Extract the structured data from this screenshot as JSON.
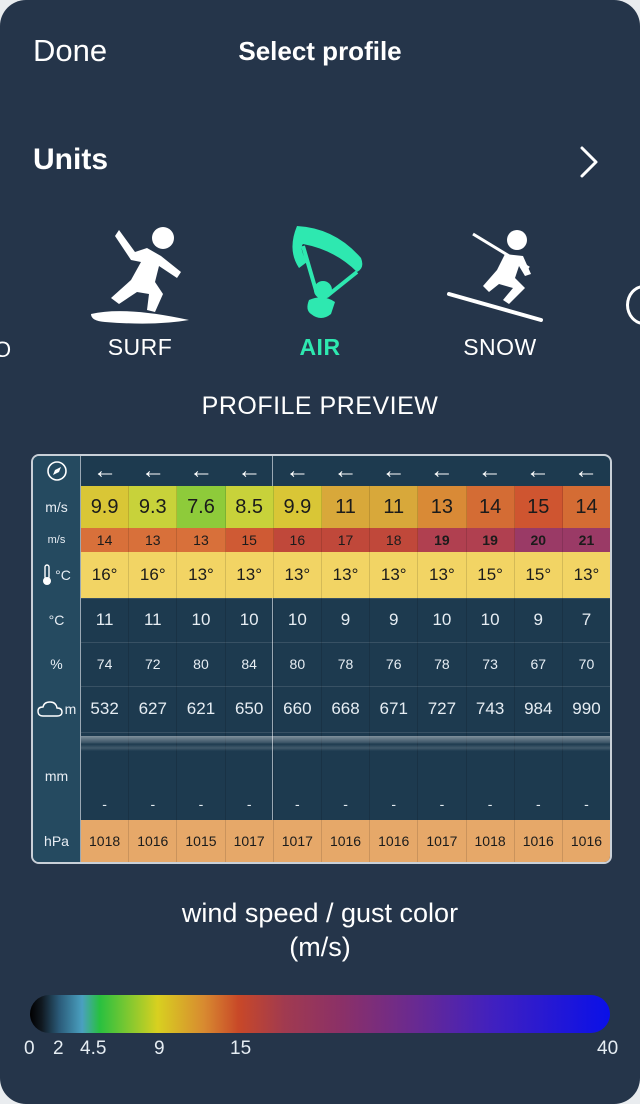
{
  "header": {
    "done_label": "Done",
    "title": "Select profile"
  },
  "units": {
    "label": "Units"
  },
  "profiles": [
    {
      "label": "SURF",
      "icon": "surf-icon",
      "active": false
    },
    {
      "label": "AIR",
      "icon": "kite-icon",
      "active": true
    },
    {
      "label": "SNOW",
      "icon": "ski-icon",
      "active": false
    }
  ],
  "edge_left_label": "O",
  "preview": {
    "title": "PROFILE PREVIEW",
    "row_labels": {
      "direction": "",
      "wind": "m/s",
      "gust": "m/s",
      "temp": "°C",
      "dew": "°C",
      "humidity": "%",
      "cloud": "m",
      "rain": "mm",
      "pressure": "hPa"
    },
    "wind": [
      "9.9",
      "9.3",
      "7.6",
      "8.5",
      "9.9",
      "11",
      "11",
      "13",
      "14",
      "15",
      "14"
    ],
    "gust": [
      "14",
      "13",
      "13",
      "15",
      "16",
      "17",
      "18",
      "19",
      "19",
      "20",
      "21"
    ],
    "temp": [
      "16°",
      "16°",
      "13°",
      "13°",
      "13°",
      "13°",
      "13°",
      "13°",
      "15°",
      "15°",
      "13°"
    ],
    "dew": [
      "11",
      "11",
      "10",
      "10",
      "10",
      "9",
      "9",
      "10",
      "10",
      "9",
      "7"
    ],
    "humidity": [
      "74",
      "72",
      "80",
      "84",
      "80",
      "78",
      "76",
      "78",
      "73",
      "67",
      "70"
    ],
    "cloud": [
      "532",
      "627",
      "621",
      "650",
      "660",
      "668",
      "671",
      "727",
      "743",
      "984",
      "990"
    ],
    "rain": [
      "-",
      "-",
      "-",
      "-",
      "-",
      "-",
      "-",
      "-",
      "-",
      "-",
      "-"
    ],
    "pressure": [
      "1018",
      "1016",
      "1015",
      "1017",
      "1017",
      "1016",
      "1016",
      "1017",
      "1018",
      "1016",
      "1016"
    ]
  },
  "legend": {
    "title_line1": "wind speed / gust color",
    "title_line2": "(m/s)",
    "ticks": [
      "0",
      "2",
      "4.5",
      "9",
      "15",
      "40"
    ]
  },
  "colors": {
    "accent": "#2ee8b0",
    "background": "#25354a",
    "pressure_fill": "#e6a869",
    "temp_fill": "#f2d464"
  }
}
